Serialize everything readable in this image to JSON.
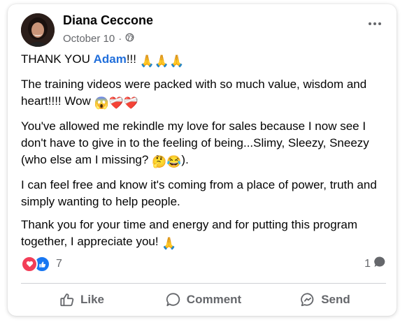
{
  "post": {
    "author": "Diana Ceccone",
    "date": "October 10",
    "separator": "·",
    "visibility_icon": "globe-icon",
    "paragraphs": {
      "p1": {
        "before": "THANK YOU ",
        "mention": "Adam",
        "after": "!!! ",
        "emoji": "🙏🙏🙏"
      },
      "p2": {
        "text": "The training videos were packed with so much value, wisdom and heart!!!! Wow ",
        "emoji": "😱❤️‍🩹❤️‍🩹"
      },
      "p3": {
        "text": "You've allowed me rekindle my love for sales because I now see I don't have to give in to the feeling of being...Slimy, Sleezy, Sneezy (who else am I missing? ",
        "emoji": "🤔😂",
        "after": ")."
      },
      "p4": {
        "text": "I can feel free and know it's coming from a place of power, truth and simply wanting to help people."
      },
      "p5": {
        "text": "Thank you for your time and energy and for putting this program together, I appreciate you! ",
        "emoji": "🙏"
      }
    }
  },
  "stats": {
    "reaction_icons": [
      "love-icon",
      "like-icon"
    ],
    "reaction_count": "7",
    "comment_count": "1"
  },
  "actions": {
    "like": "Like",
    "comment": "Comment",
    "send": "Send"
  },
  "colors": {
    "mention": "#216fdb",
    "secondary_text": "#65676b",
    "love": "#f33e58",
    "like": "#1877f2"
  }
}
